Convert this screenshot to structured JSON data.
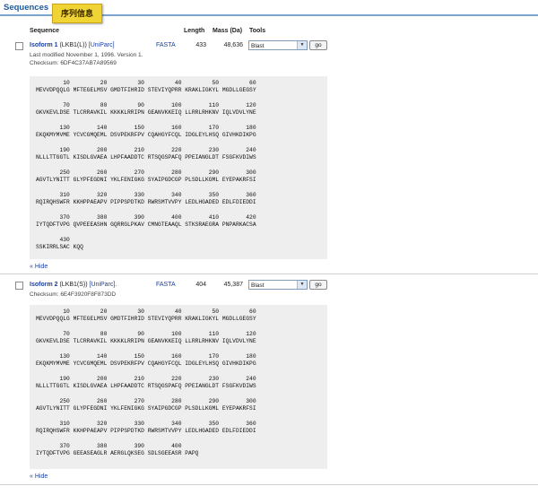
{
  "section": {
    "title": "Sequences",
    "cn_label": "序列信息"
  },
  "headers": {
    "sequence": "Sequence",
    "length": "Length",
    "mass": "Mass (Da)",
    "tools": "Tools"
  },
  "isoforms": [
    {
      "name": "Isoform 1",
      "alias": "(LKB1(L))",
      "uniparc": "[UniParc]",
      "fasta": "FASTA",
      "length": "433",
      "mass": "48,636",
      "tool": "Blast",
      "go": "go",
      "modified": "Last modified November 1, 1996. Version 1.",
      "checksum": "Checksum: 6DF4C37AB7A89569",
      "hide": "« Hide",
      "blocks": [
        {
          "num": "        10         20         30         40         50         60",
          "seq": "MEVVDPQQLG MFTEGELMSV GMDTFIHRID STEVIYQPRR KRAKLIGKYL MGDLLGEGSY"
        },
        {
          "num": "        70         80         90        100        110        120",
          "seq": "GKVKEVLDSE TLCRRAVKIL KKKKLRRIPN GEANVKKEIQ LLRRLRHKNV IQLVDVLYNE"
        },
        {
          "num": "       130        140        150        160        170        180",
          "seq": "EKQKMYMVME YCVCGMQEML DSVPEKRFPV CQAHGYFCQL IDGLEYLHSQ GIVHKDIKPG"
        },
        {
          "num": "       190        200        210        220        230        240",
          "seq": "NLLLTTGGTL KISDLGVAEA LHPFAADDTC RTSQGSPAFQ PPEIANGLDT FSGFKVDIWS"
        },
        {
          "num": "       250        260        270        280        290        300",
          "seq": "AGVTLYNITT GLYPFEGDNI YKLFENIGKG SYAIPGDCGP PLSDLLKGML EYEPAKRFSI"
        },
        {
          "num": "       310        320        330        340        350        360",
          "seq": "RQIRQHSWFR KKHPPAEAPV PIPPSPDTKD RWRSMTVVPY LEDLHGADED EDLFDIEDDI"
        },
        {
          "num": "       370        380        390        400        410        420",
          "seq": "IYTQDFTVPG QVPEEEASHN GQRRGLPKAV CMNGTEAAQL STKSRAEGRA PNPARKACSA"
        },
        {
          "num": "       430",
          "seq": "SSKIRRLSAC KQQ"
        }
      ]
    },
    {
      "name": "Isoform 2",
      "alias": "(LKB1(S))",
      "uniparc": "[UniParc].",
      "fasta": "FASTA",
      "length": "404",
      "mass": "45,387",
      "tool": "Blast",
      "go": "go",
      "modified": "",
      "checksum": "Checksum: 6E4F3920F8F873DD",
      "hide": "« Hide",
      "blocks": [
        {
          "num": "        10         20         30         40         50         60",
          "seq": "MEVVDPQQLG MFTEGELMSV GMDTFIHRID STEVIYQPRR KRAKLIGKYL MGDLLGEGSY"
        },
        {
          "num": "        70         80         90        100        110        120",
          "seq": "GKVKEVLDSE TLCRRAVKIL KKKKLRRIPN GEANVKKEIQ LLRRLRHKNV IQLVDVLYNE"
        },
        {
          "num": "       130        140        150        160        170        180",
          "seq": "EKQKMYMVME YCVCGMQEML DSVPEKRFPV CQAHGYFCQL IDGLEYLHSQ GIVHKDIKPG"
        },
        {
          "num": "       190        200        210        220        230        240",
          "seq": "NLLLTTGGTL KISDLGVAEA LHPFAADDTC RTSQGSPAFQ PPEIANGLDT FSGFKVDIWS"
        },
        {
          "num": "       250        260        270        280        290        300",
          "seq": "AGVTLYNITT GLYPFEGDNI YKLFENIGKG SYAIPGDCGP PLSDLLKGML EYEPAKRFSI"
        },
        {
          "num": "       310        320        330        340        350        360",
          "seq": "RQIRQHSWFR KKHPPAEAPV PIPPSPDTKD RWRSMTVVPY LEDLHGADED EDLFDIEDDI"
        },
        {
          "num": "       370        380        390        400",
          "seq": "IYTQDFTVPG GEEASEAGLR AERGLQKSEG SDLSGEEASR PAPQ"
        }
      ]
    }
  ]
}
